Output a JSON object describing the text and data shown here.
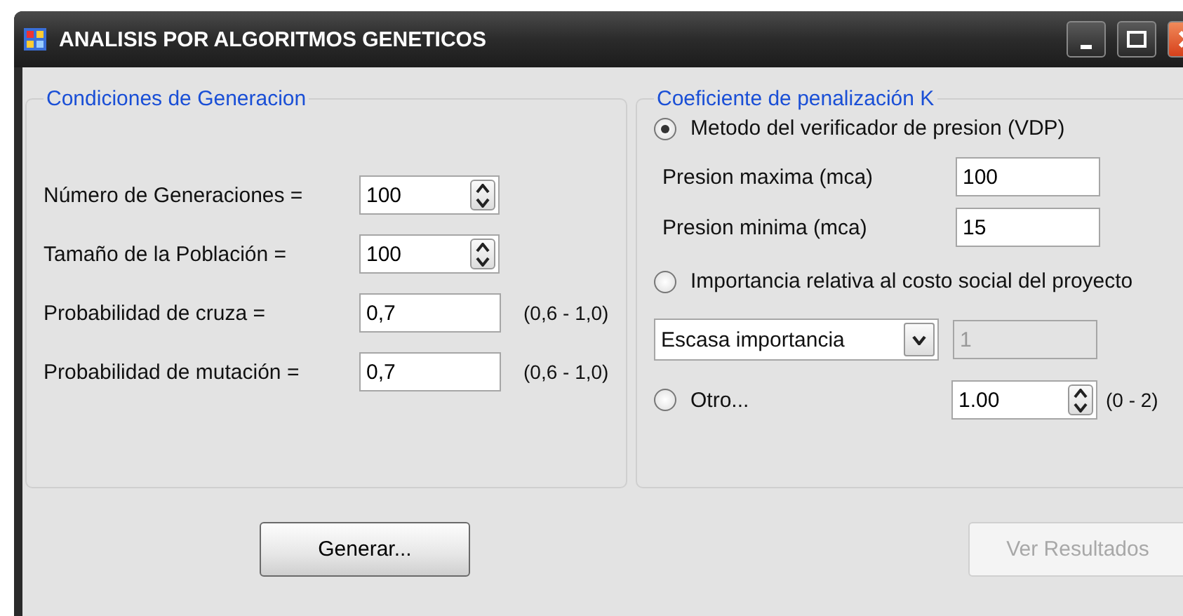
{
  "window": {
    "title": "ANALISIS POR ALGORITMOS GENETICOS"
  },
  "generation_group": {
    "title": "Condiciones de Generacion",
    "fields": [
      {
        "label": "Número de Generaciones =",
        "value": "100",
        "kind": "spin"
      },
      {
        "label": "Tamaño de la Población =",
        "value": "100",
        "kind": "spin"
      },
      {
        "label": "Probabilidad de cruza =",
        "value": "0,7",
        "kind": "text",
        "range": "(0,6 - 1,0)"
      },
      {
        "label": "Probabilidad de mutación =",
        "value": "0,7",
        "kind": "text",
        "range": "(0,6 - 1,0)"
      }
    ]
  },
  "penalty_group": {
    "title": "Coeficiente de penalización K",
    "options": [
      {
        "label": "Metodo del verificador de presion (VDP)",
        "selected": true
      },
      {
        "label": "Importancia relativa al costo social del proyecto",
        "selected": false
      },
      {
        "label": "Otro...",
        "selected": false
      }
    ],
    "pressure_fields": [
      {
        "label": "Presion maxima (mca)",
        "value": "100"
      },
      {
        "label": "Presion minima (mca)",
        "value": "15"
      }
    ],
    "importance_combo": {
      "value": "Escasa importancia"
    },
    "importance_value": {
      "value": "1",
      "disabled": true
    },
    "other_value": {
      "value": "1.00",
      "range": "(0 - 2)"
    }
  },
  "buttons": [
    {
      "label": "Generar...",
      "disabled": false
    },
    {
      "label": "Ver Resultados",
      "disabled": true
    }
  ]
}
